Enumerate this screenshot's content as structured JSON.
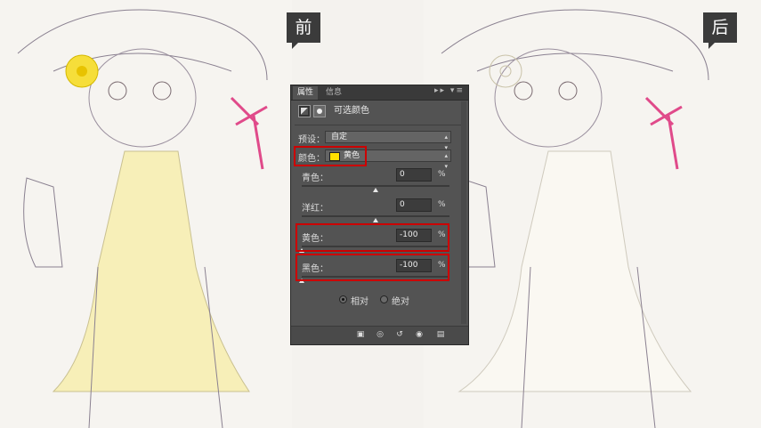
{
  "labels": {
    "before": "前",
    "after": "后"
  },
  "panel": {
    "tabs": [
      {
        "label": "属性"
      },
      {
        "label": "信息"
      }
    ],
    "tab_controls": "▸▸ ▾≡",
    "title": "可选颜色",
    "preset_label": "预设：",
    "preset_value": "自定",
    "color_label": "颜色：",
    "color_value": "黄色",
    "color_swatch": "#ffe000",
    "sliders": [
      {
        "label": "青色：",
        "value": "0",
        "unit": "%",
        "level": 0.5
      },
      {
        "label": "洋红：",
        "value": "0",
        "unit": "%",
        "level": 0.5
      },
      {
        "label": "黄色：",
        "value": "-100",
        "unit": "%",
        "level": 0.0
      },
      {
        "label": "黑色：",
        "value": "-100",
        "unit": "%",
        "level": 0.0
      }
    ],
    "method": {
      "relative": "相对",
      "absolute": "绝对",
      "selected": "relative"
    },
    "footer_icons": [
      "clip-to-layer-icon",
      "view-previous-icon",
      "reset-icon",
      "visibility-icon",
      "delete-icon"
    ]
  },
  "colors": {
    "highlight": "#cc0000",
    "panel_bg": "#535353",
    "art_bg": "#f4f2ee",
    "dress_yellow": "#f4e9a0"
  }
}
